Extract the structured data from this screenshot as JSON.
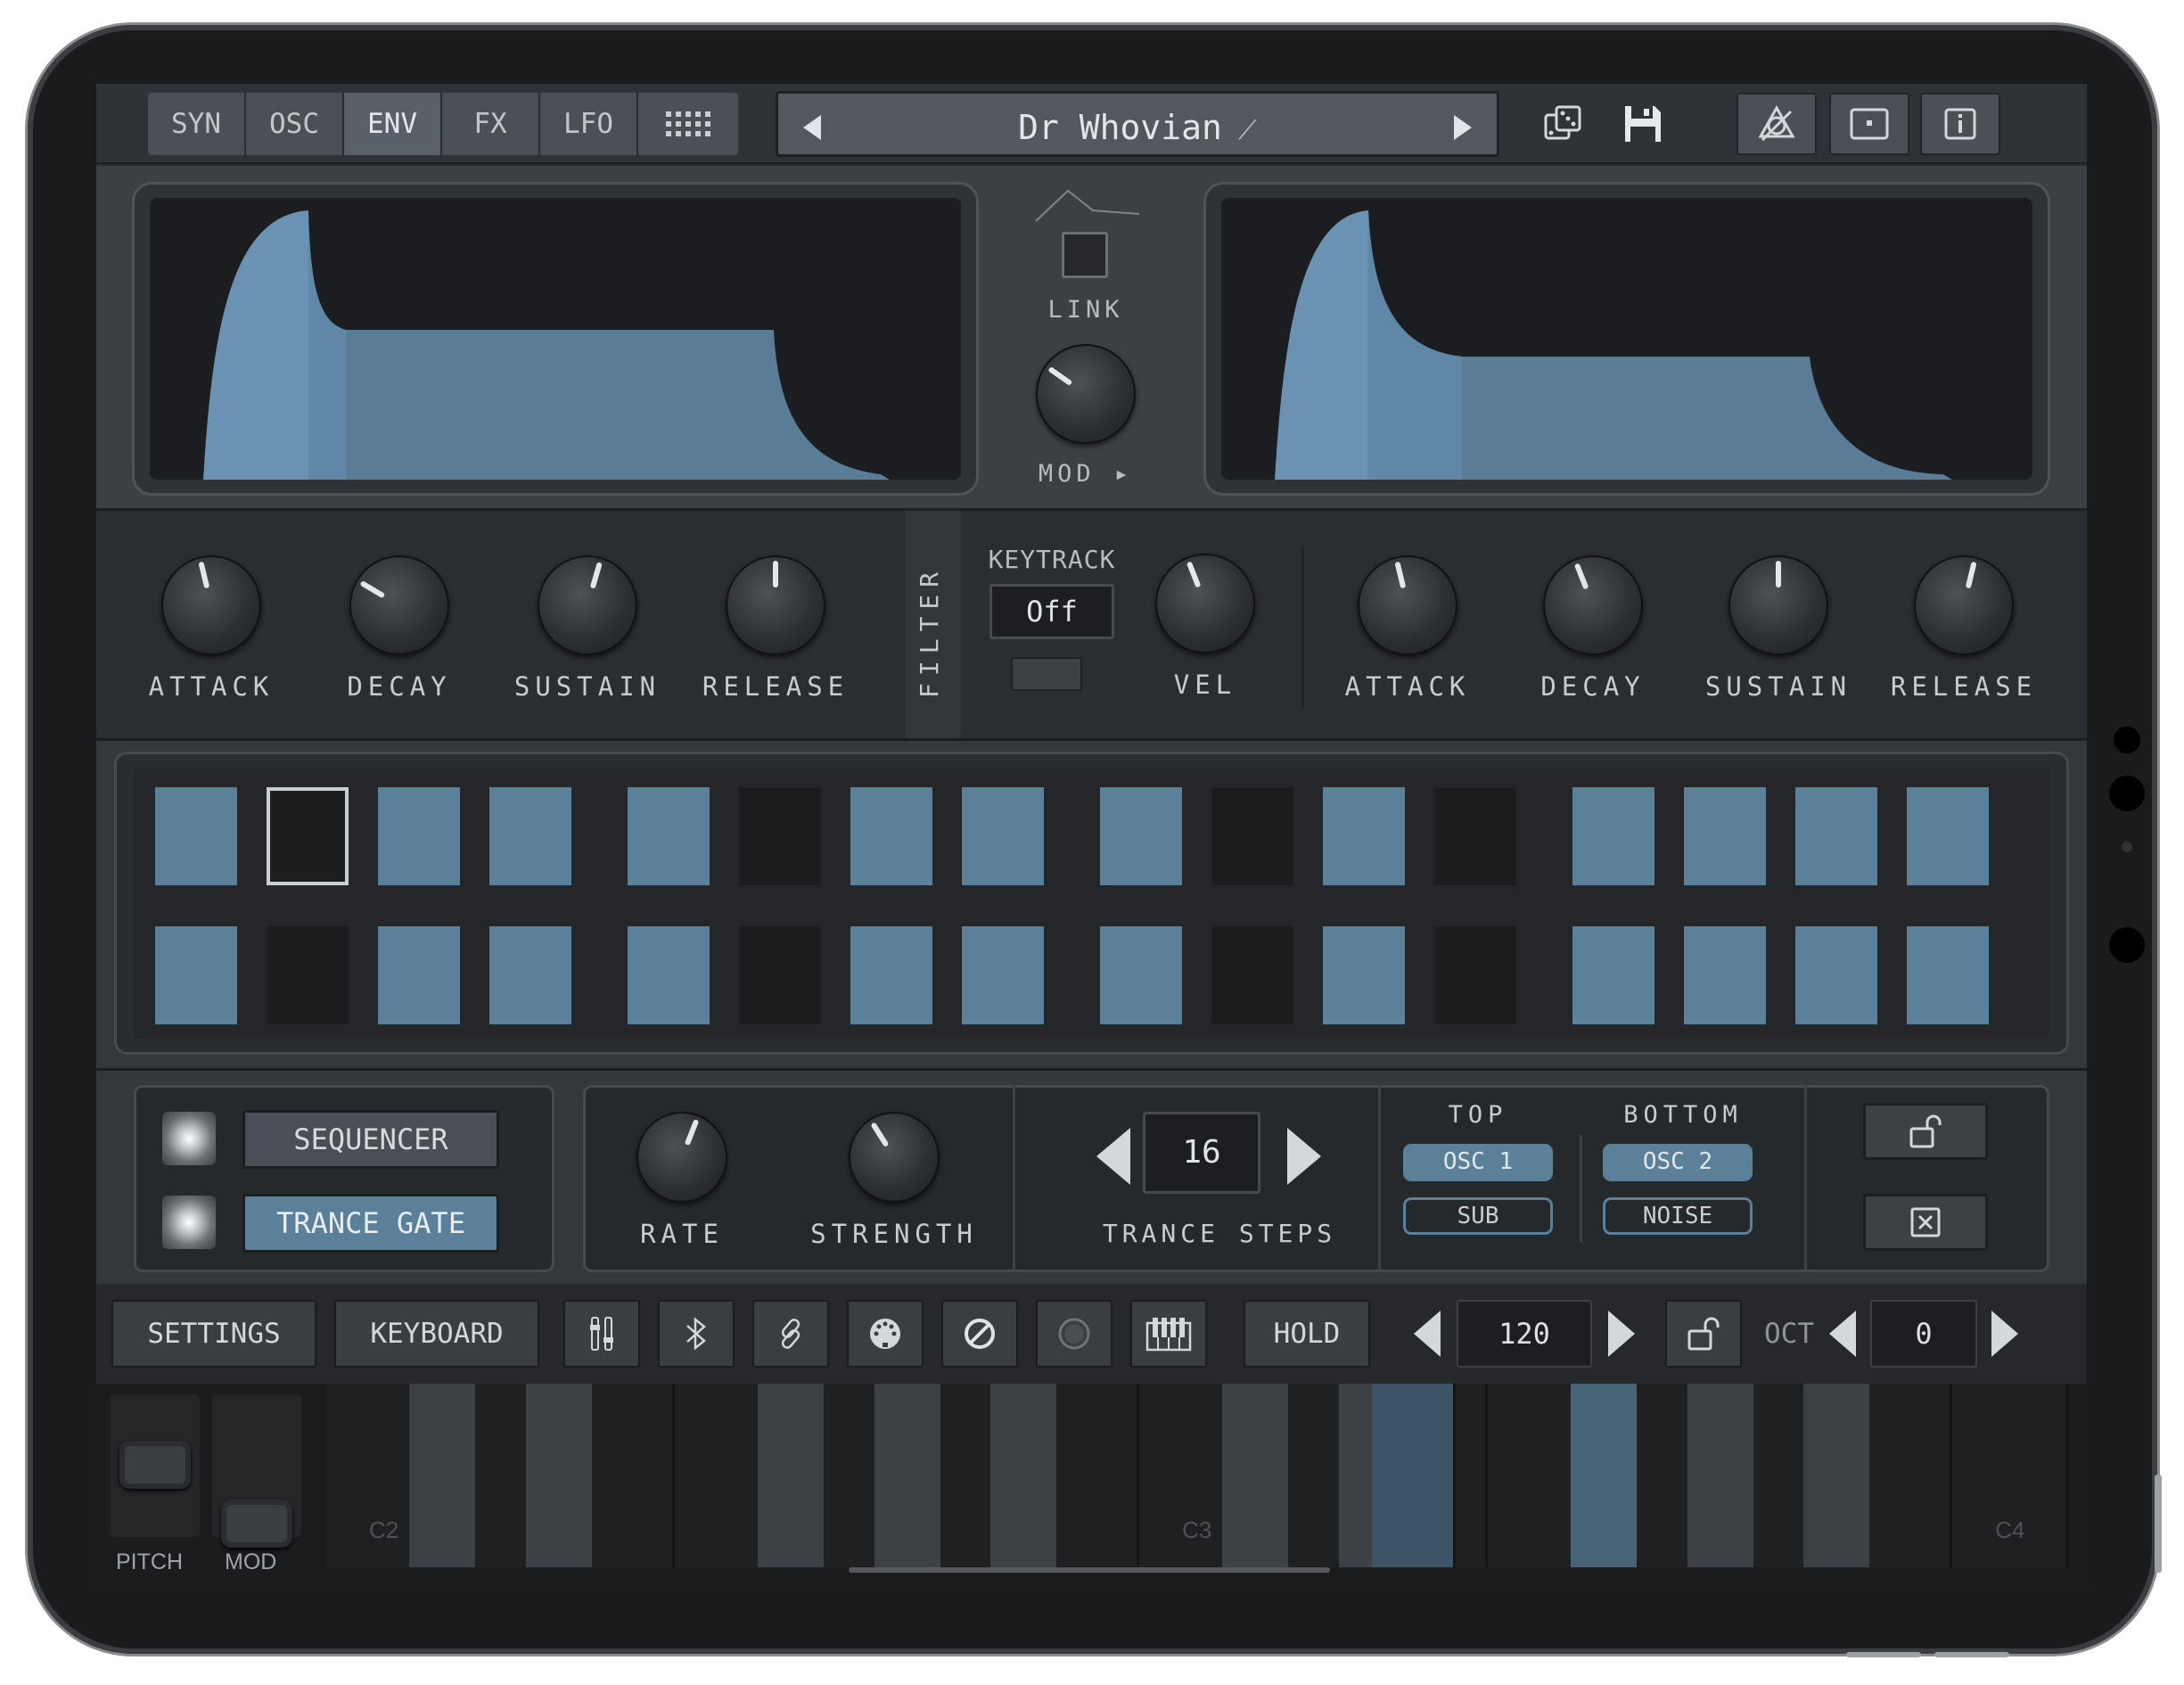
{
  "tabs": [
    {
      "label": "SYN"
    },
    {
      "label": "OSC"
    },
    {
      "label": "ENV",
      "active": true
    },
    {
      "label": "FX"
    },
    {
      "label": "LFO"
    }
  ],
  "preset": {
    "name": "Dr Whovian"
  },
  "icons": {
    "grid": "grid-icon",
    "prev": "triangle-left-icon",
    "next": "triangle-right-icon",
    "wand": "magic-wand-icon",
    "dice": "dice-icon",
    "save": "floppy-disk-icon",
    "unknown1": "no-sound-icon",
    "window": "window-icon",
    "info": "info-icon"
  },
  "envelope_link": {
    "link_label": "LINK",
    "mod_label": "MOD ▸"
  },
  "amp_env": {
    "knobs": [
      {
        "label": "ATTACK",
        "level": 0.45
      },
      {
        "label": "DECAY",
        "level": 0.28
      },
      {
        "label": "SUSTAIN",
        "level": 0.56
      },
      {
        "label": "RELEASE",
        "level": 0.5
      }
    ]
  },
  "filter": {
    "section_label": "FILTER",
    "keytrack_label": "KEYTRACK",
    "keytrack_value": "Off",
    "vel_label": "VEL",
    "vel_level": 0.42,
    "knobs": [
      {
        "label": "ATTACK",
        "level": 0.45
      },
      {
        "label": "DECAY",
        "level": 0.42
      },
      {
        "label": "SUSTAIN",
        "level": 0.5
      },
      {
        "label": "RELEASE",
        "level": 0.55
      }
    ]
  },
  "sequencer": {
    "row1": [
      1,
      0,
      1,
      1,
      1,
      0,
      1,
      1,
      1,
      0,
      1,
      0,
      1,
      1,
      1,
      1
    ],
    "row2": [
      1,
      0,
      1,
      1,
      1,
      0,
      1,
      1,
      1,
      0,
      1,
      0,
      1,
      1,
      1,
      1
    ],
    "selected_step": 1
  },
  "gate": {
    "modes": [
      {
        "label": "SEQUENCER",
        "active": false
      },
      {
        "label": "TRANCE GATE",
        "active": true
      }
    ],
    "rate_label": "RATE",
    "rate_level": 0.58,
    "strength_label": "STRENGTH",
    "strength_level": 0.38,
    "steps_value": "16",
    "steps_label": "TRANCE STEPS",
    "top_label": "TOP",
    "bottom_label": "BOTTOM",
    "top_sources": [
      {
        "label": "OSC 1",
        "on": true
      },
      {
        "label": "SUB",
        "on": false
      }
    ],
    "bottom_sources": [
      {
        "label": "OSC 2",
        "on": true
      },
      {
        "label": "NOISE",
        "on": false
      }
    ],
    "unlock_icon": "unlock-icon",
    "clear_icon": "close-box-icon"
  },
  "bottombar": {
    "settings_label": "SETTINGS",
    "keyboard_label": "KEYBOARD",
    "hold_label": "HOLD",
    "tempo_value": "120",
    "oct_label": "OCT",
    "oct_value": "0",
    "icons": [
      "sliders-icon",
      "bluetooth-icon",
      "link-icon",
      "midi-icon",
      "block-icon",
      "record-icon",
      "piano-icon"
    ]
  },
  "keyboard": {
    "pitch_label": "PITCH",
    "mod_label": "MOD",
    "labels": [
      "C2",
      "C3",
      "C4"
    ]
  },
  "colors": {
    "accent": "#5a8199",
    "envelope_fill": "#6a93b3",
    "panel": "#2a2d31",
    "screen": "#1b1d20"
  }
}
